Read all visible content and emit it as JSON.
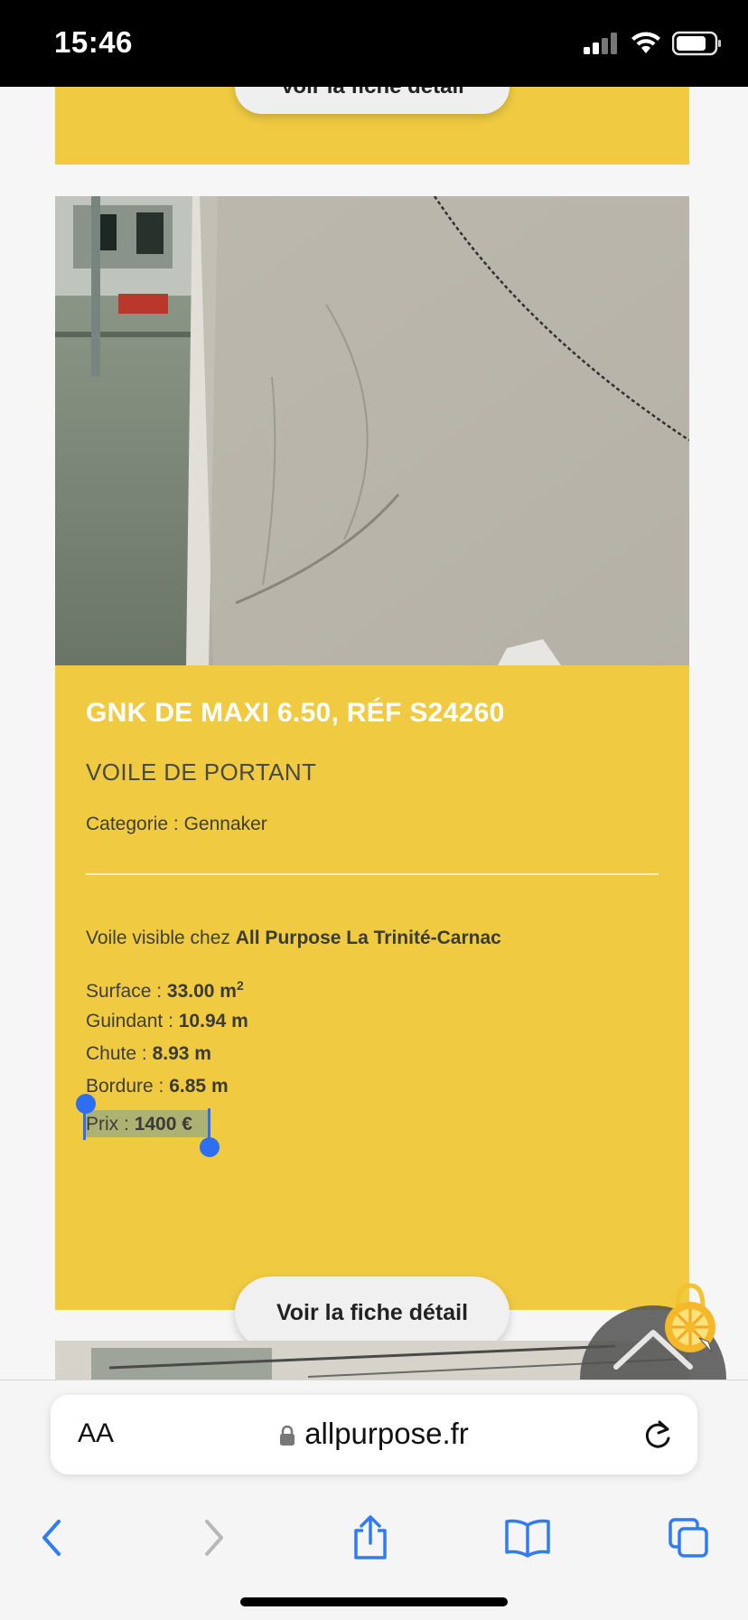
{
  "status_bar": {
    "time": "15:46"
  },
  "previous_card": {
    "button_label": "Voir la fiche détail"
  },
  "card": {
    "title": "GNK DE MAXI 6.50, RÉF S24260",
    "subtitle": "VOILE DE PORTANT",
    "category_label": "Categorie :",
    "category_value": "Gennaker",
    "location_label": "Voile visible chez",
    "location_value": "All Purpose La Trinité-Carnac",
    "specs": [
      {
        "label": "Surface :",
        "value": "33.00 m",
        "sup": "2"
      },
      {
        "label": "Guindant :",
        "value": "10.94 m",
        "sup": ""
      },
      {
        "label": "Chute :",
        "value": "8.93 m",
        "sup": ""
      },
      {
        "label": "Bordure :",
        "value": "6.85 m",
        "sup": ""
      }
    ],
    "price_label": "Prix :",
    "price_value": "1400 €",
    "button_label": "Voir la fiche détail"
  },
  "browser": {
    "aa_label": "AA",
    "url": "allpurpose.fr"
  },
  "colors": {
    "card_yellow": "#f0cb41",
    "selection_blue": "#2d6ff0",
    "safari_blue": "#2f7cf6"
  },
  "icons": [
    "signal-icon",
    "wifi-icon",
    "battery-icon",
    "lock-icon",
    "reload-icon",
    "back-icon",
    "forward-icon",
    "share-icon",
    "bookmarks-icon",
    "tabs-icon",
    "scroll-top-icon",
    "lifebuoy-icon"
  ]
}
